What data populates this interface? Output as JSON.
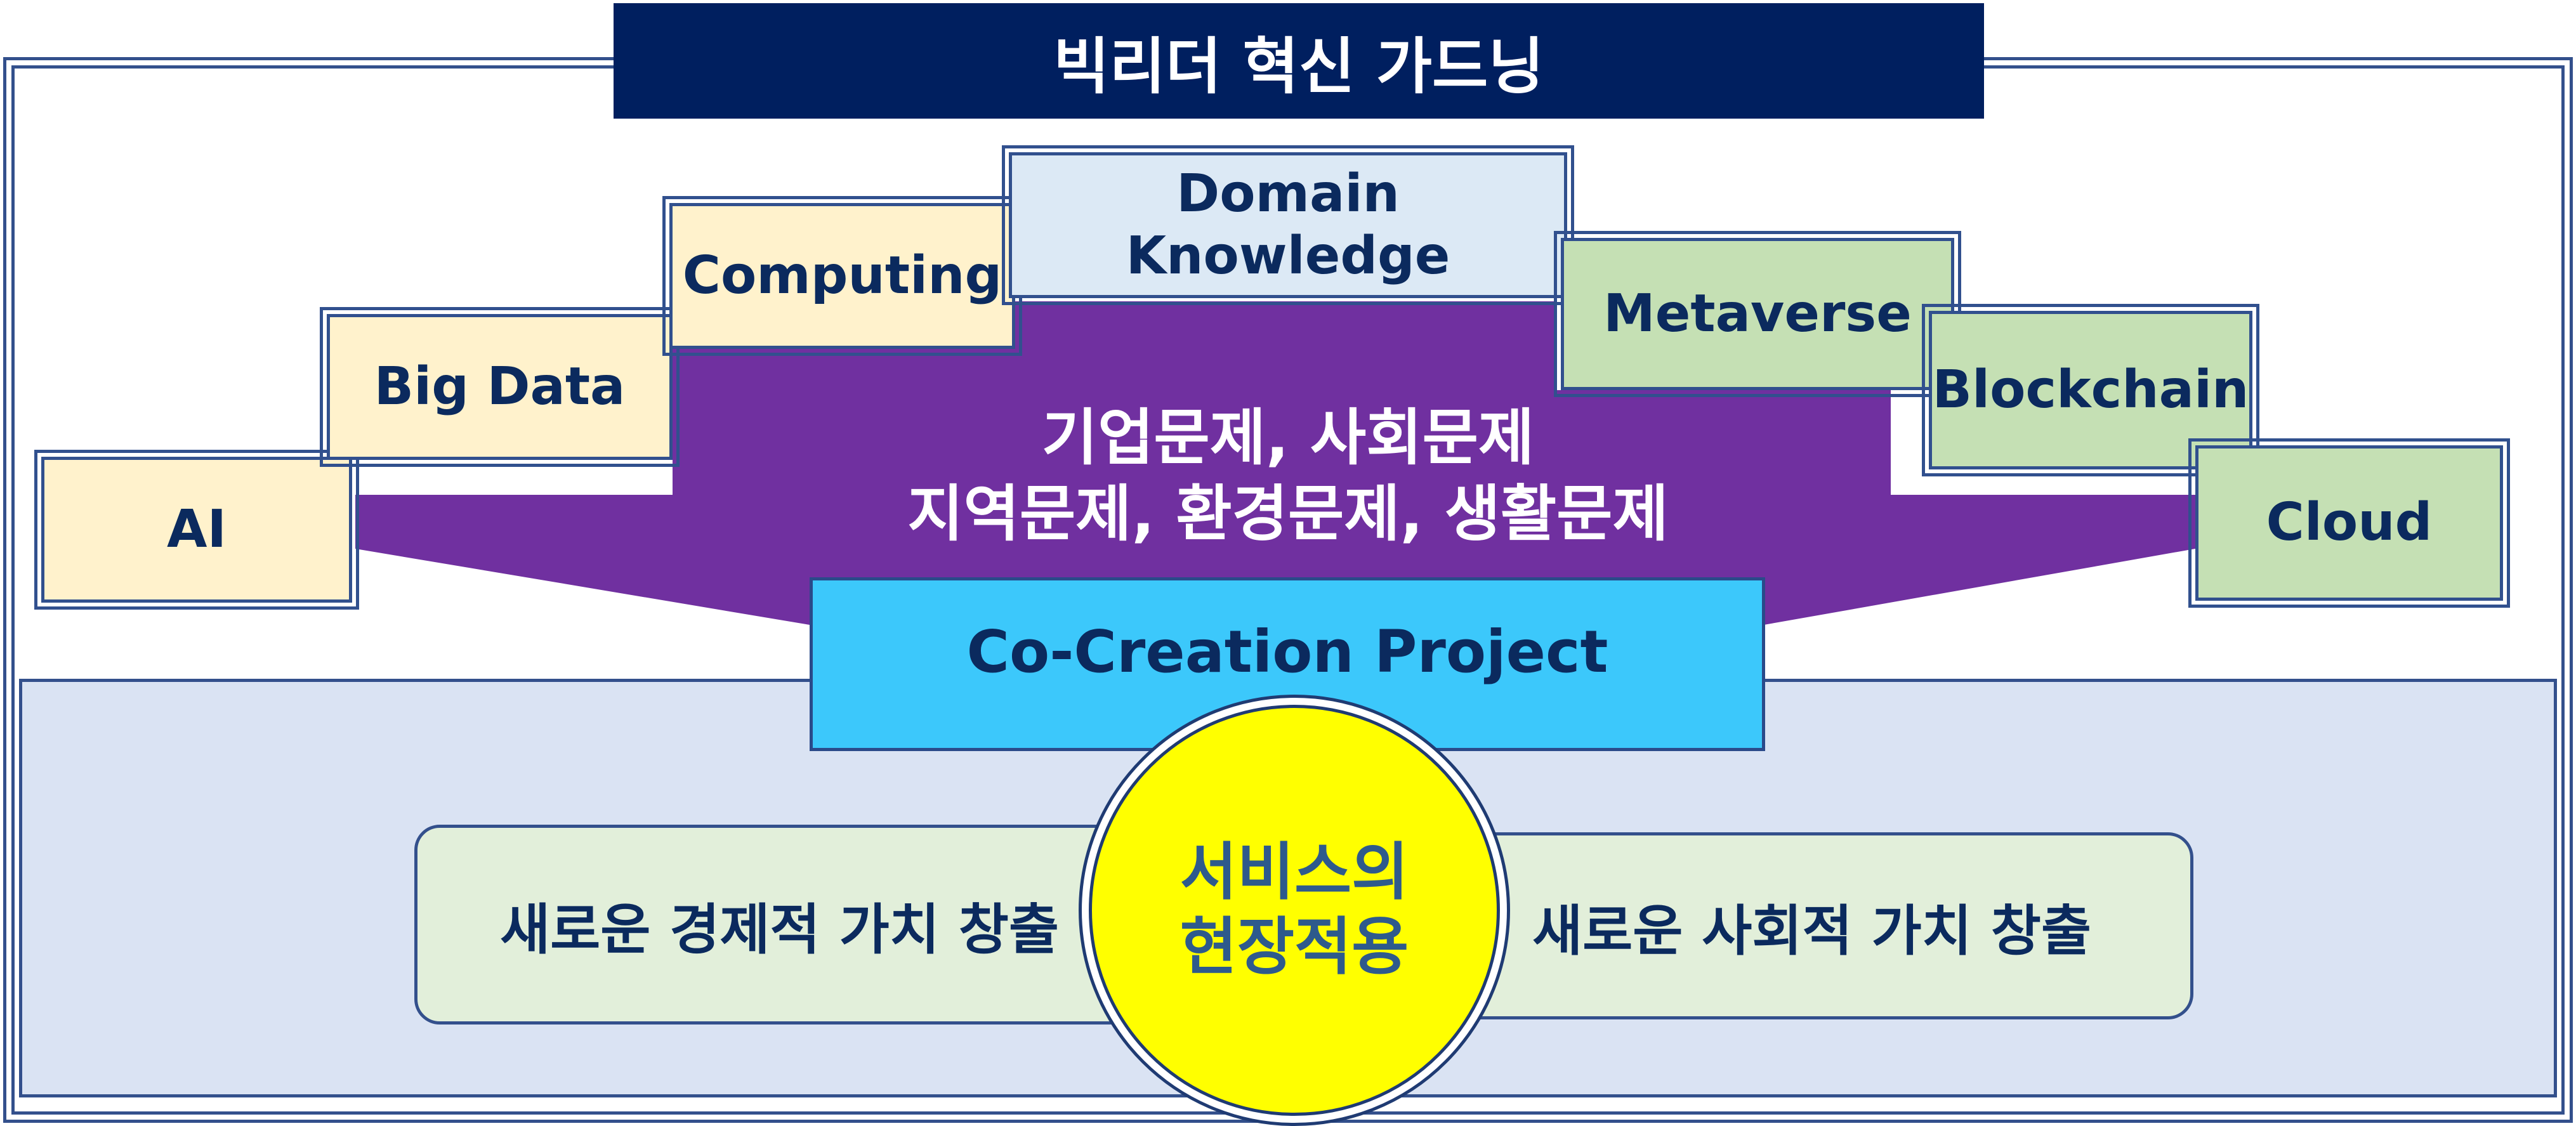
{
  "title": "빅리더 혁신 가드닝",
  "technologies": [
    {
      "label": "AI",
      "color": "#fff2cc"
    },
    {
      "label": "Big Data",
      "color": "#fff2cc"
    },
    {
      "label": "Computing",
      "color": "#fff2cc"
    },
    {
      "label": "Domain Knowledge",
      "line1": "Domain",
      "line2": "Knowledge",
      "color": "#dce9f5"
    },
    {
      "label": "Metaverse",
      "color": "#c5e0b4"
    },
    {
      "label": "Blockchain",
      "color": "#c5e0b4"
    },
    {
      "label": "Cloud",
      "color": "#c5e0b4"
    }
  ],
  "problems": {
    "line1": "기업문제, 사회문제",
    "line2": "지역문제, 환경문제, 생활문제"
  },
  "project": "Co-Creation Project",
  "center": {
    "line1": "서비스의",
    "line2": "현장적용"
  },
  "values": {
    "economic": "새로운 경제적 가치 창출",
    "social": "새로운 사회적 가치 창출"
  },
  "colors": {
    "title_bg": "#001f5f",
    "funnel": "#7030a0",
    "project_bg": "#3cc8fb",
    "center_bg": "#ffff00",
    "panel_bg": "#dae3f3",
    "value_bg": "#e2efda"
  }
}
